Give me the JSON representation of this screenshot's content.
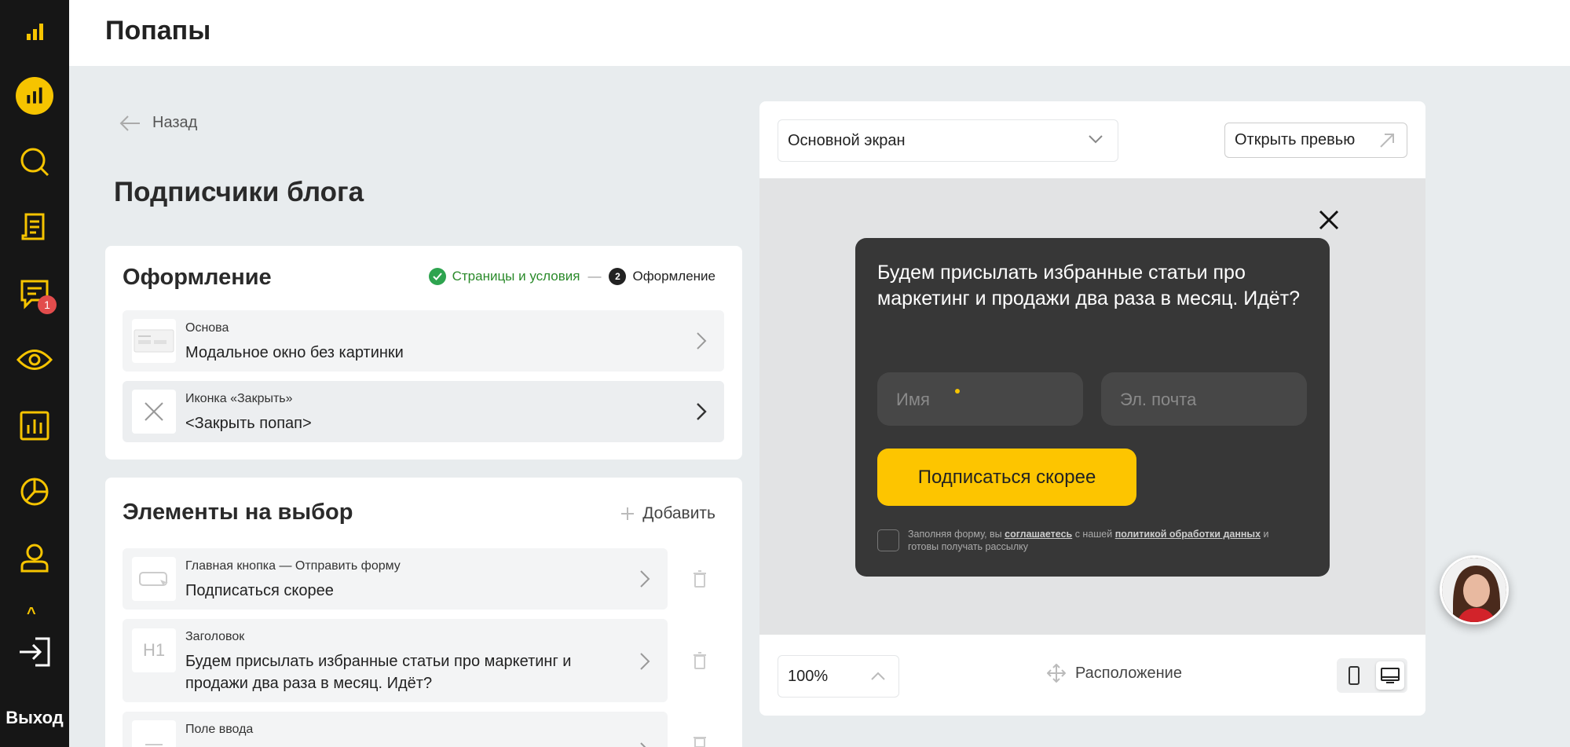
{
  "sidebar": {
    "badge_count": "1",
    "caret": "^",
    "exit_label": "Выход",
    "icons": [
      "logo-icon",
      "dashboard-icon",
      "search-icon",
      "document-icon",
      "chat-icon",
      "eye-icon",
      "chart-icon",
      "pie-chart-icon",
      "user-icon",
      "logout-icon"
    ],
    "accent": "#f6c400"
  },
  "header": {
    "title": "Попапы"
  },
  "back_label": "Назад",
  "page_title": "Подписчики блога",
  "design_card": {
    "title": "Оформление",
    "steps": [
      {
        "label": "Страницы и условия",
        "state": "done"
      },
      {
        "number": "2",
        "label": "Оформление",
        "state": "current"
      }
    ],
    "step_separator": "—",
    "rows": [
      {
        "label": "Основа",
        "value": "Модальное окно без картинки",
        "icon": "layout-thumb-icon"
      },
      {
        "label": "Иконка «Закрыть»",
        "value": "<Закрыть попап>",
        "icon": "close-icon"
      }
    ]
  },
  "elements_card": {
    "title": "Элементы на выбор",
    "add_label": "Добавить",
    "rows": [
      {
        "label": "Главная кнопка — Отправить форму",
        "value": "Подписаться скорее",
        "icon": "button-icon"
      },
      {
        "label": "Заголовок",
        "value": "Будем присылать избранные статьи про маркетинг и продажи два раза в месяц. Идёт?",
        "icon": "heading-icon"
      },
      {
        "label": "Поле ввода",
        "value": "",
        "icon": "input-icon"
      }
    ]
  },
  "preview": {
    "screen_select": "Основной экран",
    "open_preview_label": "Открыть превью",
    "popup": {
      "heading": "Будем присылать избранные статьи про маркетинг и продажи два раза в месяц. Идёт?",
      "name_placeholder": "Имя",
      "email_placeholder": "Эл. почта",
      "button_label": "Подписаться скорее",
      "consent_prefix": "Заполняя форму, вы",
      "consent_agree": "соглашаетесь",
      "consent_mid": "с нашей",
      "consent_policy": "политикой обработки данных",
      "consent_suffix": "и готовы получать рассылку",
      "bg_color": "#373737",
      "button_color": "#fdc500"
    },
    "zoom": "100%",
    "layout_label": "Расположение"
  }
}
